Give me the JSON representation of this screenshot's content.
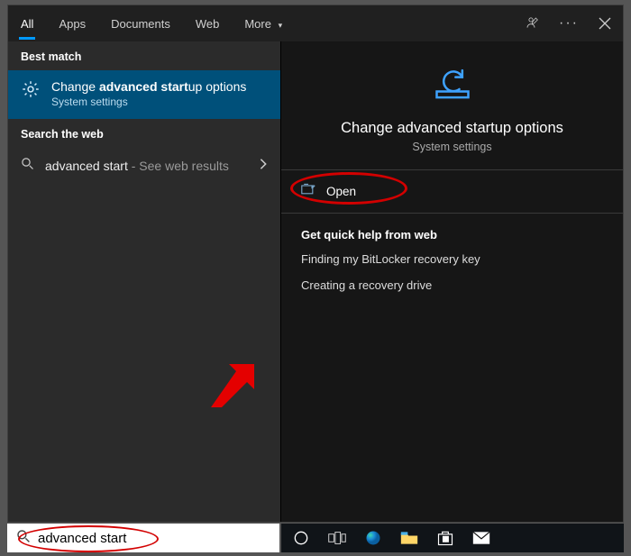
{
  "tabs": {
    "all": "All",
    "apps": "Apps",
    "documents": "Documents",
    "web": "Web",
    "more": "More"
  },
  "left": {
    "best_match_label": "Best match",
    "best_match": {
      "title_prefix": "Change ",
      "title_bold": "advanced start",
      "title_suffix": "up options",
      "subtitle": "System settings"
    },
    "search_web_label": "Search the web",
    "web_result": {
      "term": "advanced start",
      "hint": " - See web results"
    }
  },
  "right": {
    "title": "Change advanced startup options",
    "subtitle": "System settings",
    "open_label": "Open",
    "quick_help_heading": "Get quick help from web",
    "quick_links": [
      "Finding my BitLocker recovery key",
      "Creating a recovery drive"
    ]
  },
  "search_input_value": "advanced start",
  "taskbar_icons": [
    "cortana-circle",
    "task-view",
    "edge",
    "explorer",
    "store",
    "mail"
  ]
}
